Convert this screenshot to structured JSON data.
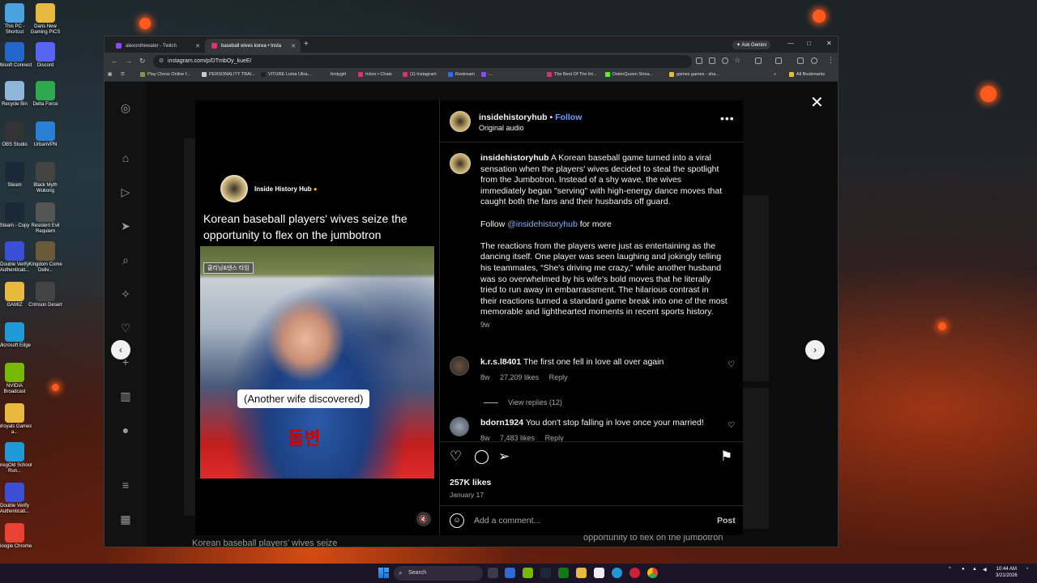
{
  "desktop": {
    "icons": [
      {
        "label": "This PC - Shortcut",
        "color": "#4aa3df"
      },
      {
        "label": "Ubisoft Connect",
        "color": "#2266cc"
      },
      {
        "label": "Recycle Bin",
        "color": "#8fb6d8"
      },
      {
        "label": "OBS Studio",
        "color": "#333333"
      },
      {
        "label": "Steam",
        "color": "#1b2838"
      },
      {
        "label": "Steam - Copy",
        "color": "#1b2838"
      },
      {
        "label": "Double Verify Authenticati...",
        "color": "#3a4fd6"
      },
      {
        "label": "GAMIZ",
        "color": "#e7b93e"
      },
      {
        "label": "Microsoft Edge",
        "color": "#1f9ad6"
      },
      {
        "label": "NVIDIA Broadcast",
        "color": "#76b900"
      },
      {
        "label": "Wroyals Games a...",
        "color": "#e7b93e"
      },
      {
        "label": "GregOld School Run...",
        "color": "#1f9ad6"
      },
      {
        "label": "Double Verify Authenticati...",
        "color": "#3a4fd6"
      },
      {
        "label": "Google Chrome",
        "color": "#e94235"
      },
      {
        "label": "Dans New Gaming PICS",
        "color": "#e7b93e"
      },
      {
        "label": "Discord",
        "color": "#5865f2"
      },
      {
        "label": "Delta Force",
        "color": "#2fa84f"
      },
      {
        "label": "UrbanVPN",
        "color": "#2a7fd4"
      },
      {
        "label": "Black Myth Wukong",
        "color": "#444444"
      },
      {
        "label": "Resident Evil Requiem",
        "color": "#555555"
      },
      {
        "label": "Kingdom Come Deliv...",
        "color": "#6b5a3a"
      },
      {
        "label": "Crimson Desert",
        "color": "#444444"
      }
    ]
  },
  "browser": {
    "tabs": [
      {
        "title": "alexonthewater - Twitch",
        "color": "#9146ff",
        "active": false
      },
      {
        "title": "baseball wives korea • Insta",
        "color": "#e1306c",
        "active": true
      }
    ],
    "new_tab": "+",
    "ask_gemini": "Ask Gemini",
    "window_controls": {
      "minimize": "—",
      "maximize": "□",
      "close": "✕"
    },
    "url": "instagram.com/p/DTmbOy_kueE/",
    "bookmarks": [
      {
        "label": "Play Chess Online f...",
        "color": "#7a9a4a"
      },
      {
        "label": "PERSONALITY TRAI...",
        "color": "#cccccc"
      },
      {
        "label": "VITURE Luma Ultra...",
        "color": "#222222"
      },
      {
        "label": "fentygirl",
        "color": "#333333"
      },
      {
        "label": "Inbox • Chats",
        "color": "#e1306c"
      },
      {
        "label": "(1) Instagram",
        "color": "#e1306c"
      },
      {
        "label": "Restream",
        "color": "#2b6cff"
      },
      {
        "label": "...",
        "color": "#9146ff"
      },
      {
        "label": "The Best Of The Int...",
        "color": "#e1306c"
      },
      {
        "label": "DelenQueen Strea...",
        "color": "#53fc18"
      },
      {
        "label": "games games - sha...",
        "color": "#e7b93e"
      }
    ],
    "all_bookmarks": "All Bookmarks"
  },
  "instagram": {
    "video": {
      "handle": "Inside History Hub",
      "verified_badge": "●",
      "title": "Korean baseball players' wives seize the opportunity to flex on the jumbotron",
      "scoreboard_tag": "클리닝&댄스 타임",
      "caption": "(Another wife discovered)",
      "korean_text": "돌변",
      "mute_icon": "🔇"
    },
    "post": {
      "username": "insidehistoryhub",
      "follow": "Follow",
      "dot": "•",
      "audio": "Original audio",
      "more": "•••",
      "caption_user": "insidehistoryhub",
      "caption_p1": "A Korean baseball game turned into a viral sensation when the players' wives decided to steal the spotlight from the Jumbotron. Instead of a shy wave, the wives immediately began \"serving\" with high-energy dance moves that caught both the fans and their husbands off guard.",
      "caption_follow_pre": "Follow ",
      "caption_mention": "@insidehistoryhub",
      "caption_follow_post": " for more",
      "caption_p3": "The reactions from the players were just as entertaining as the dancing itself. One player was seen laughing and jokingly telling his teammates, “She's driving me crazy,” while another husband was so overwhelmed by his wife's bold moves that he literally tried to run away in embarrassment. The hilarious contrast in their reactions turned a standard game break into one of the most memorable and lighthearted moments in recent sports history.",
      "caption_age": "9w",
      "comments": [
        {
          "user": "k.r.s.l8401",
          "text": "The first one fell in love all over again",
          "age": "8w",
          "likes": "27,209 likes",
          "reply": "Reply"
        },
        {
          "user": "bdorn1924",
          "text": "You don't stop falling in love once your married!",
          "age": "8w",
          "likes": "7,483 likes",
          "reply": "Reply"
        }
      ],
      "view_replies": "View replies (12)",
      "likes": "257K likes",
      "date": "January 17",
      "comment_placeholder": "Add a comment...",
      "post_button": "Post"
    },
    "background_caption_left": "Korean baseball players' wives seize",
    "background_caption_right": "opportunity to flex on the jumbotron"
  },
  "taskbar": {
    "search": "Search",
    "clock_time": "10:44 AM",
    "clock_date": "3/21/2026"
  }
}
